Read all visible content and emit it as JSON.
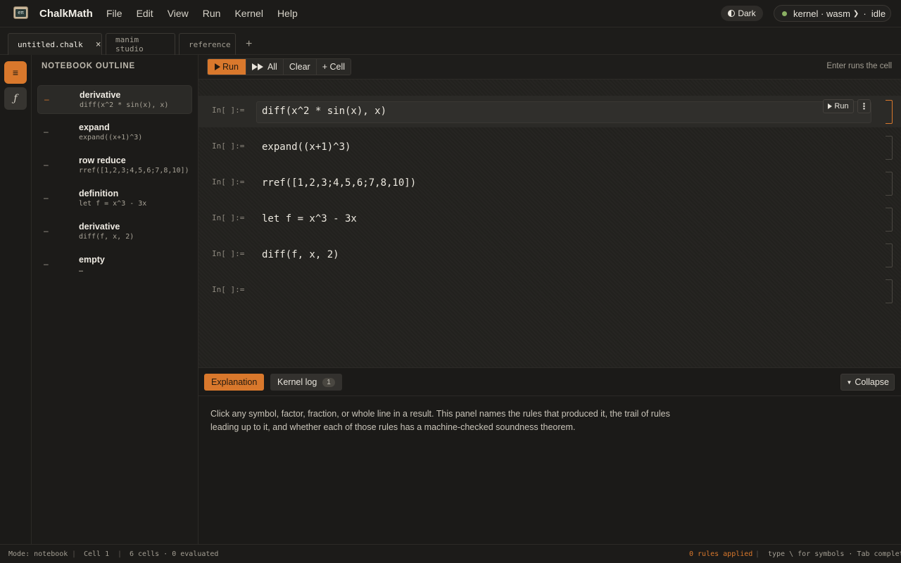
{
  "app": {
    "name": "ChalkMath",
    "logo_text": "eπ",
    "menu": [
      "File",
      "Edit",
      "View",
      "Run",
      "Kernel",
      "Help"
    ],
    "theme_label": "Dark",
    "kernel": {
      "label": "kernel · wasm",
      "state": "idle",
      "status_color": "#8bb063"
    }
  },
  "tabs": [
    {
      "label": "untitled.chalk",
      "active": true,
      "close": "×"
    },
    {
      "label": "manim studio",
      "active": false
    },
    {
      "label": "reference",
      "active": false
    }
  ],
  "tab_add": "+",
  "rail": {
    "outline_icon": "≡",
    "functions_icon": "ƒ"
  },
  "outline": {
    "title": "NOTEBOOK OUTLINE",
    "items": [
      {
        "name": "derivative",
        "expr": "diff(x^2 * sin(x), x)",
        "marker": "–",
        "selected": true
      },
      {
        "name": "expand",
        "expr": "expand((x+1)^3)",
        "marker": "–"
      },
      {
        "name": "row reduce",
        "expr": "rref([1,2,3;4,5,6;7,8,10])",
        "marker": "–"
      },
      {
        "name": "definition",
        "expr": "let f = x^3 - 3x",
        "marker": "–"
      },
      {
        "name": "derivative",
        "expr": "diff(f, x, 2)",
        "marker": "–"
      },
      {
        "name": "empty",
        "expr": "…",
        "marker": "–"
      }
    ]
  },
  "toolbar": {
    "run": "Run",
    "run_all": "All",
    "clear": "Clear",
    "add_cell": "+ Cell",
    "hint": "Enter runs the cell"
  },
  "cells": [
    {
      "prompt": "In[ ]:=",
      "code": "diff(x^2 * sin(x), x)",
      "active": true,
      "run_label": "Run",
      "menu": "⋮"
    },
    {
      "prompt": "In[ ]:=",
      "code": "expand((x+1)^3)"
    },
    {
      "prompt": "In[ ]:=",
      "code": "rref([1,2,3;4,5,6;7,8,10])"
    },
    {
      "prompt": "In[ ]:=",
      "code": "let f = x^3 - 3x"
    },
    {
      "prompt": "In[ ]:=",
      "code": "diff(f, x, 2)"
    },
    {
      "prompt": "In[ ]:=",
      "code": ""
    }
  ],
  "panel": {
    "tabs": [
      {
        "label": "Explanation",
        "active": true
      },
      {
        "label": "Kernel log",
        "badge": "1"
      }
    ],
    "collapse_label": "Collapse",
    "text": "Click any symbol, factor, fraction, or whole line in a result. This panel names the rules that produced it, the trail of rules leading up to it, and whether each of those rules has a machine-checked soundness theorem."
  },
  "status": {
    "mode": "Mode: notebook",
    "cell": "Cell 1",
    "counts": "6 cells · 0 evaluated",
    "rules": "0 rules applied",
    "hint": "type \\ for symbols · Tab completes"
  },
  "colors": {
    "accent": "#d9782c",
    "background": "#1b1a18",
    "cells_background": "#23221f"
  }
}
